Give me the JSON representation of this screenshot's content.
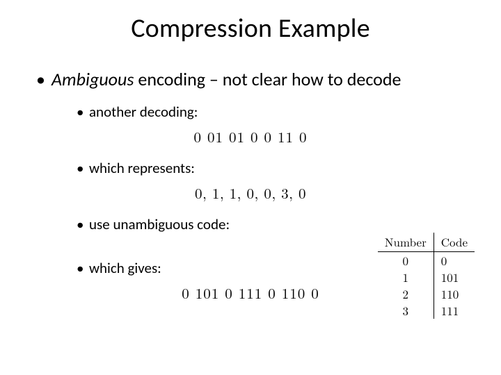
{
  "title": "Compression Example",
  "main_bullet": {
    "emph": "Ambiguous",
    "rest": " encoding – not clear how to decode"
  },
  "sub_bullets": [
    {
      "label": "another decoding:",
      "math": "0 01 01 0 0 11 0"
    },
    {
      "label": "which represents:",
      "math": "0, 1, 1, 0, 0, 3, 0"
    },
    {
      "label": "use unambiguous code:",
      "math": ""
    },
    {
      "label": "which gives:",
      "math": "0 101 0 111 0 110 0"
    }
  ],
  "code_table": {
    "headers": [
      "Number",
      "Code"
    ],
    "rows": [
      [
        "0",
        "0"
      ],
      [
        "1",
        "101"
      ],
      [
        "2",
        "110"
      ],
      [
        "3",
        "111"
      ]
    ]
  }
}
